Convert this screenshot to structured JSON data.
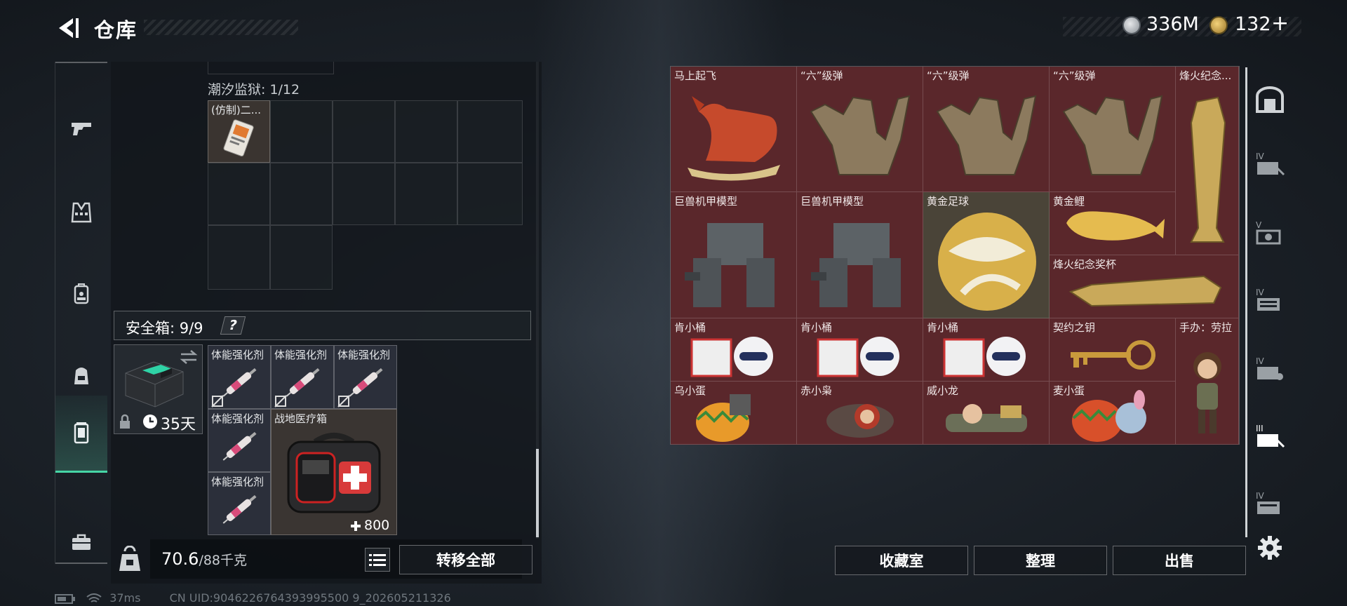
{
  "header": {
    "title": "仓库",
    "currency_silver": "336M",
    "currency_gold": "132",
    "currency_gold_add": "+"
  },
  "left_panel": {
    "prison_label": "潮汐监狱: 1/12",
    "prison_item_name": "(仿制)二...",
    "safe_box": {
      "label": "安全箱: 9/9",
      "help": "?",
      "duration": "35天"
    },
    "items": [
      {
        "name": "体能强化剂"
      },
      {
        "name": "体能强化剂"
      },
      {
        "name": "体能强化剂"
      },
      {
        "name": "体能强化剂"
      },
      {
        "name": "战地医疗箱",
        "value": "800"
      },
      {
        "name": "体能强化剂"
      }
    ],
    "weight_current": "70.6",
    "weight_max": "/88千克",
    "transfer_all": "转移全部"
  },
  "collection": {
    "items": [
      {
        "name": "马上起飞"
      },
      {
        "name": "“六”级弹"
      },
      {
        "name": "“六”级弹"
      },
      {
        "name": "“六”级弹"
      },
      {
        "name": "烽火纪念..."
      },
      {
        "name": "巨兽机甲模型"
      },
      {
        "name": "巨兽机甲模型"
      },
      {
        "name": "黄金足球"
      },
      {
        "name": "黄金鲤"
      },
      {
        "name": "烽火纪念奖杯"
      },
      {
        "name": "肯小桶"
      },
      {
        "name": "肯小桶"
      },
      {
        "name": "肯小桶"
      },
      {
        "name": "契约之钥"
      },
      {
        "name": "手办：劳拉"
      },
      {
        "name": "乌小蛋"
      },
      {
        "name": "赤小枭"
      },
      {
        "name": "威小龙"
      },
      {
        "name": "麦小蛋"
      }
    ],
    "buttons": {
      "collection_room": "收藏室",
      "organize": "整理",
      "sell": "出售"
    }
  },
  "right_sidebar": {
    "tabs": [
      "vault-icon",
      "IV",
      "V",
      "IV",
      "IV",
      "III",
      "IV"
    ]
  },
  "status_bar": {
    "ping": "37ms",
    "uid": "CN UID:9046226764393995500 9_202605211326"
  }
}
